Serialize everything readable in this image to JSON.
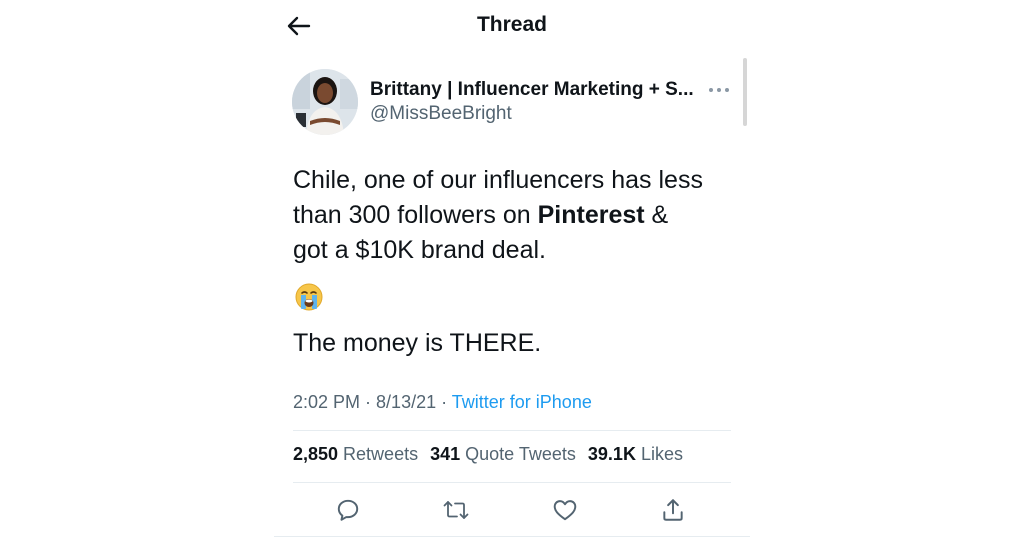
{
  "header": {
    "title": "Thread"
  },
  "author": {
    "name": "Brittany | Influencer Marketing + S...",
    "handle": "@MissBeeBright"
  },
  "tweet": {
    "line1": "Chile, one of our influencers has less",
    "line2_before": "than 300 followers on ",
    "line2_bold": "Pinterest",
    "line2_after": " &",
    "line3": "got a $10K brand deal.",
    "emoji": "loudly-crying-face",
    "line4": "The money is THERE."
  },
  "meta": {
    "time": "2:02 PM",
    "date": "8/13/21",
    "separator": " · ",
    "source": "Twitter for iPhone"
  },
  "stats": {
    "retweets_count": "2,850",
    "retweets_label": " Retweets",
    "quotes_count": "341",
    "quotes_label": " Quote Tweets",
    "likes_count": "39.1K",
    "likes_label": " Likes"
  },
  "colors": {
    "text": "#0f1419",
    "secondary": "#536471",
    "link": "#1d9bf0",
    "divider": "#e6ecf0",
    "icon": "#536471"
  },
  "icons": [
    "back-arrow-icon",
    "more-icon",
    "reply-icon",
    "retweet-icon",
    "like-icon",
    "share-icon"
  ]
}
